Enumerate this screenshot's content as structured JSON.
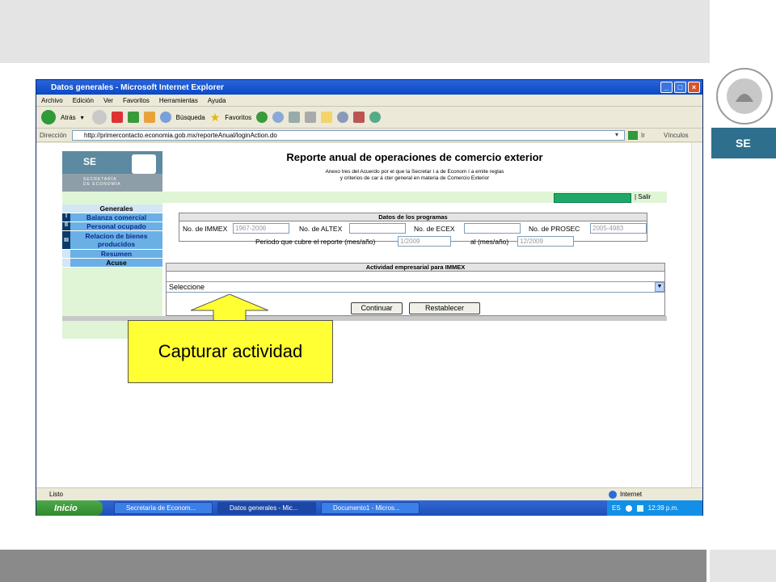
{
  "window": {
    "title": "Datos generales - Microsoft Internet Explorer"
  },
  "menu": [
    "Archivo",
    "Edición",
    "Ver",
    "Favoritos",
    "Herramientas",
    "Ayuda"
  ],
  "toolbar": {
    "back": "Atrás",
    "search": "Búsqueda",
    "favorites": "Favoritos"
  },
  "address": {
    "label": "Dirección",
    "url": "http://primercontacto.economia.gob.mx/reporteAnual/loginAction.do",
    "go": "Ir",
    "links": "Vínculos"
  },
  "page": {
    "logo_text": "SE",
    "logo_sub_1": "SECRETARÍA",
    "logo_sub_2": "DE ECONOMÍA",
    "title": "Reporte anual de operaciones de comercio exterior",
    "subtitle_1": "Anexo tres del Acuerdo por el que la Secretar í a de Econom í a emite reglas",
    "subtitle_2": "y criterios de car á cter general en materia de Comercio Exterior",
    "logout": "| Salir",
    "nav": {
      "header": "Generales",
      "items": [
        {
          "num": "I",
          "label": "Balanza comercial"
        },
        {
          "num": "II",
          "label": "Personal ocupado"
        },
        {
          "num": "III",
          "label": "Relacion de bienes producidos"
        },
        {
          "num": "",
          "label": "Resumen"
        },
        {
          "num": "",
          "label": "Acuse"
        }
      ]
    },
    "programs": {
      "title": "Datos de los programas",
      "immex_label": "No. de IMMEX",
      "immex_value": "1967-2006",
      "altex_label": "No. de ALTEX",
      "altex_value": "",
      "ecex_label": "No. de ECEX",
      "ecex_value": "",
      "prosec_label": "No. de PROSEC",
      "prosec_value": "2005-4983",
      "period_label": "Periodo que cubre el reporte (mes/año)",
      "period_from": "1/2009",
      "period_to_label": "al (mes/año)",
      "period_to": "12/2009"
    },
    "activity": {
      "title": "Actividad empresarial para IMMEX",
      "selected": "Seleccione",
      "continue": "Continuar",
      "reset": "Restablecer"
    }
  },
  "status": {
    "left": "Listo",
    "zone": "Internet"
  },
  "taskbar": {
    "start": "Inicio",
    "tasks": [
      "Secretaría de Econom...",
      "Datos generales - Mic...",
      "Documento1 - Micros..."
    ],
    "lang": "ES",
    "clock": "12:39 p.m."
  },
  "slide": {
    "side_label": "SE",
    "callout": "Capturar actividad"
  },
  "colors": {
    "callout": "#ffff33",
    "titlebar": "#0b49c7",
    "nav_item": "#6ab0e6",
    "green_panel": "#dff5d5"
  }
}
